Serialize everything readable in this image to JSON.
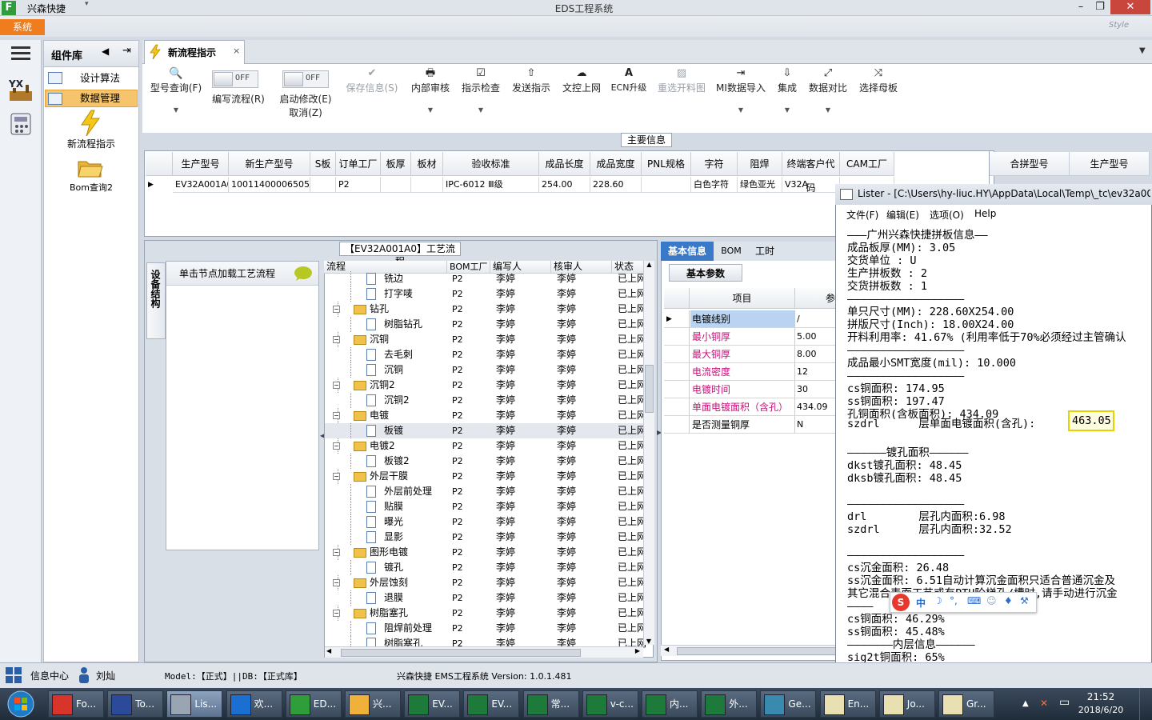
{
  "window": {
    "app_name": "兴森快捷",
    "title": "EDS工程系统",
    "style_label": "Style"
  },
  "menu": {
    "system": "系统"
  },
  "library": {
    "title": "组件库",
    "items": [
      {
        "label": "设计算法"
      },
      {
        "label": "数据管理"
      }
    ],
    "tools": [
      {
        "label": "新流程指示"
      },
      {
        "label": "Bom查询2"
      }
    ]
  },
  "tab": {
    "label": "新流程指示"
  },
  "toolbar": {
    "type_query": "型号查询(F)",
    "edit_flow": "编写流程(R)",
    "start_modify": "启动修改(E)",
    "cancel": "取消(Z)",
    "toggle_off": "OFF",
    "save_info": "保存信息(S)",
    "internal_review": "内部审核",
    "instruction_check": "指示检查",
    "send_instruction": "发送指示",
    "doc_upload": "文控上网",
    "ecn_upgrade": "ECN升级",
    "reselect_layout": "重选开料图",
    "mi_import": "MI数据导入",
    "integrate": "集成",
    "data_compare": "数据对比",
    "select_mother": "选择母板"
  },
  "main_info": {
    "title": "主要信息",
    "columns": [
      "生产型号",
      "新生产型号",
      "S板",
      "订单工厂",
      "板厚",
      "板材",
      "验收标准",
      "成品长度",
      "成品宽度",
      "PNL规格",
      "字符",
      "阻焊",
      "终端客户代码",
      "CAM工厂"
    ],
    "right_columns": [
      "合拼型号",
      "生产型号"
    ],
    "row": [
      "EV32A001A0",
      "10011400006505",
      "",
      "P2",
      "",
      "",
      "IPC-6012 Ⅲ级",
      "254.00",
      "228.60",
      "",
      "白色字符",
      "绿色亚光",
      "V32A",
      ""
    ]
  },
  "process": {
    "title": "【EV32A001A0】工艺流程",
    "side_tab": "设备结构",
    "node_hint": "单击节点加载工艺流程",
    "columns": [
      "流程",
      "BOM工厂",
      "编写人",
      "核审人",
      "状态"
    ],
    "rows": [
      {
        "name": "铣边",
        "level": 1,
        "bom": "P2",
        "writer": "李婷",
        "reviewer": "李婷",
        "status": "已上网"
      },
      {
        "name": "打字唛",
        "level": 1,
        "bom": "P2",
        "writer": "李婷",
        "reviewer": "李婷",
        "status": "已上网"
      },
      {
        "name": "钻孔",
        "level": 0,
        "bom": "P2",
        "writer": "李婷",
        "reviewer": "李婷",
        "status": "已上网"
      },
      {
        "name": "树脂钻孔",
        "level": 1,
        "bom": "P2",
        "writer": "李婷",
        "reviewer": "李婷",
        "status": "已上网"
      },
      {
        "name": "沉铜",
        "level": 0,
        "bom": "P2",
        "writer": "李婷",
        "reviewer": "李婷",
        "status": "已上网"
      },
      {
        "name": "去毛刺",
        "level": 1,
        "bom": "P2",
        "writer": "李婷",
        "reviewer": "李婷",
        "status": "已上网"
      },
      {
        "name": "沉铜",
        "level": 1,
        "bom": "P2",
        "writer": "李婷",
        "reviewer": "李婷",
        "status": "已上网"
      },
      {
        "name": "沉铜2",
        "level": 0,
        "bom": "P2",
        "writer": "李婷",
        "reviewer": "李婷",
        "status": "已上网"
      },
      {
        "name": "沉铜2",
        "level": 1,
        "bom": "P2",
        "writer": "李婷",
        "reviewer": "李婷",
        "status": "已上网"
      },
      {
        "name": "电镀",
        "level": 0,
        "bom": "P2",
        "writer": "李婷",
        "reviewer": "李婷",
        "status": "已上网"
      },
      {
        "name": "板镀",
        "level": 1,
        "bom": "P2",
        "writer": "李婷",
        "reviewer": "李婷",
        "status": "已上网",
        "selected": true
      },
      {
        "name": "电镀2",
        "level": 0,
        "bom": "P2",
        "writer": "李婷",
        "reviewer": "李婷",
        "status": "已上网"
      },
      {
        "name": "板镀2",
        "level": 1,
        "bom": "P2",
        "writer": "李婷",
        "reviewer": "李婷",
        "status": "已上网"
      },
      {
        "name": "外层干膜",
        "level": 0,
        "bom": "P2",
        "writer": "李婷",
        "reviewer": "李婷",
        "status": "已上网"
      },
      {
        "name": "外层前处理",
        "level": 1,
        "bom": "P2",
        "writer": "李婷",
        "reviewer": "李婷",
        "status": "已上网"
      },
      {
        "name": "贴膜",
        "level": 1,
        "bom": "P2",
        "writer": "李婷",
        "reviewer": "李婷",
        "status": "已上网"
      },
      {
        "name": "曝光",
        "level": 1,
        "bom": "P2",
        "writer": "李婷",
        "reviewer": "李婷",
        "status": "已上网"
      },
      {
        "name": "显影",
        "level": 1,
        "bom": "P2",
        "writer": "李婷",
        "reviewer": "李婷",
        "status": "已上网"
      },
      {
        "name": "图形电镀",
        "level": 0,
        "bom": "P2",
        "writer": "李婷",
        "reviewer": "李婷",
        "status": "已上网"
      },
      {
        "name": "镀孔",
        "level": 1,
        "bom": "P2",
        "writer": "李婷",
        "reviewer": "李婷",
        "status": "已上网"
      },
      {
        "name": "外层蚀刻",
        "level": 0,
        "bom": "P2",
        "writer": "李婷",
        "reviewer": "李婷",
        "status": "已上网"
      },
      {
        "name": "退膜",
        "level": 1,
        "bom": "P2",
        "writer": "李婷",
        "reviewer": "李婷",
        "status": "已上网"
      },
      {
        "name": "树脂塞孔",
        "level": 0,
        "bom": "P2",
        "writer": "李婷",
        "reviewer": "李婷",
        "status": "已上网"
      },
      {
        "name": "阻焊前处理",
        "level": 1,
        "bom": "P2",
        "writer": "李婷",
        "reviewer": "李婷",
        "status": "已上网"
      },
      {
        "name": "树脂塞孔",
        "level": 1,
        "bom": "P2",
        "writer": "李婷",
        "reviewer": "李婷",
        "status": "已上网"
      }
    ]
  },
  "basic_info": {
    "tabs": [
      "基本信息",
      "BOM",
      "工时"
    ],
    "sub_tab": "基本参数",
    "col_item": "项目",
    "col_param": "参",
    "rows": [
      {
        "label": "电镀线别",
        "value": "/",
        "pink": false,
        "selected": true
      },
      {
        "label": "最小铜厚",
        "value": "5.00",
        "pink": true
      },
      {
        "label": "最大铜厚",
        "value": "8.00",
        "pink": true
      },
      {
        "label": "电流密度",
        "value": "12",
        "pink": true
      },
      {
        "label": "电镀时间",
        "value": "30",
        "pink": true
      },
      {
        "label": "单面电镀面积（含孔）",
        "value": "434.09",
        "pink": true
      },
      {
        "label": "是否测量铜厚",
        "value": "N",
        "pink": false
      }
    ]
  },
  "lister": {
    "title": "Lister - [C:\\Users\\hy-liuc.HY\\AppData\\Local\\Temp\\_tc\\ev32a001",
    "menu": [
      "文件(F)",
      "编辑(E)",
      "选项(O)",
      "Help"
    ],
    "lines": [
      "———广州兴森快捷拼板信息——",
      "成品板厚(MM): 3.05",
      "交货单位 : U",
      "生产拼板数 : 2",
      "交货拼板数 : 1",
      "——————————————————",
      "单只尺寸(MM): 228.60X254.00",
      "拼版尺寸(Inch): 18.00X24.00",
      "开料利用率: 41.67% (利用率低于70%必须经过主管确认",
      "——————————————————",
      "成品最小SMT宽度(mil): 10.000",
      "——————————————————",
      "cs铜面积: 174.95",
      "ss铜面积: 197.47",
      "孔铜面积(含板面积): 434.09",
      "",
      "",
      "——————镀孔面积——————",
      "dkst镀孔面积: 48.45",
      "dksb镀孔面积: 48.45",
      "",
      "——————————————————",
      "drl        层孔内面积:6.98",
      "szdrl      层孔内面积:32.52",
      "",
      "——————————————————",
      "cs沉金面积: 26.48",
      "ss沉金面积: 6.51自动计算沉金面积只适合普通沉金及",
      "其它混合表面工艺或有PTH阶梯孔/槽时,请手动进行沉金",
      "————",
      "cs铜面积: 46.29%",
      "ss铜面积: 45.48%",
      "———————内层信息——————",
      "sig2t铜面积: 65%"
    ],
    "szdrl_label": "szdrl      层单面电镀面积(含孔):",
    "highlight_value": "463.05"
  },
  "status": {
    "info_center": "信息中心",
    "user": "刘灿",
    "model_db": "Model:【正式】||DB:【正式库】",
    "version": "兴森快捷 EMS工程系统 Version: 1.0.1.481"
  },
  "taskbar": {
    "items": [
      "Fo...",
      "To...",
      "Lis...",
      "欢...",
      "ED...",
      "兴...",
      "EV...",
      "EV...",
      "常...",
      "v-c...",
      "内...",
      "外...",
      "Ge...",
      "En...",
      "Jo...",
      "Gr..."
    ],
    "time": "21:52",
    "date": "2018/6/20"
  },
  "colors": {
    "accent": "#f07d1d",
    "pink_label": "#c8117a",
    "highlight_border": "#e6d200",
    "selected_row": "#b9d3f0"
  }
}
